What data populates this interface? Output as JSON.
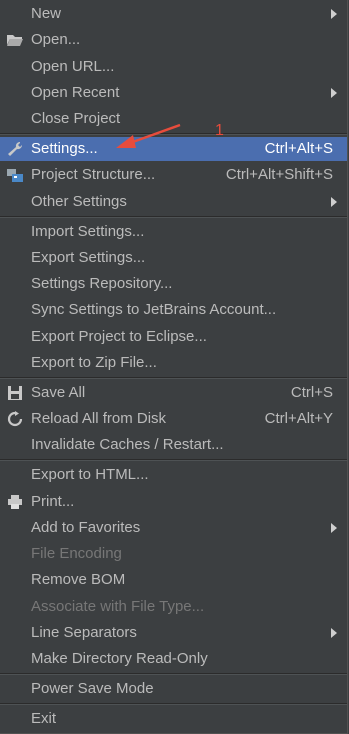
{
  "menu": {
    "new": "New",
    "open": "Open...",
    "open_url": "Open URL...",
    "open_recent": "Open Recent",
    "close_project": "Close Project",
    "settings": "Settings...",
    "settings_shortcut": "Ctrl+Alt+S",
    "project_structure": "Project Structure...",
    "project_structure_shortcut": "Ctrl+Alt+Shift+S",
    "other_settings": "Other Settings",
    "import_settings": "Import Settings...",
    "export_settings": "Export Settings...",
    "settings_repository": "Settings Repository...",
    "sync_settings": "Sync Settings to JetBrains Account...",
    "export_eclipse": "Export Project to Eclipse...",
    "export_zip": "Export to Zip File...",
    "save_all": "Save All",
    "save_all_shortcut": "Ctrl+S",
    "reload_all": "Reload All from Disk",
    "reload_all_shortcut": "Ctrl+Alt+Y",
    "invalidate_caches": "Invalidate Caches / Restart...",
    "export_html": "Export to HTML...",
    "print": "Print...",
    "add_favorites": "Add to Favorites",
    "file_encoding": "File Encoding",
    "remove_bom": "Remove BOM",
    "associate_file_type": "Associate with File Type...",
    "line_separators": "Line Separators",
    "make_readonly": "Make Directory Read-Only",
    "power_save": "Power Save Mode",
    "exit": "Exit"
  },
  "annotation": {
    "number": "1",
    "color": "#e74c3c"
  },
  "icons": {
    "open": "folder-icon",
    "settings": "wrench-icon",
    "project_structure": "project-structure-icon",
    "save_all": "save-icon",
    "reload_all": "reload-icon",
    "print": "printer-icon",
    "submenu": "chevron-right-icon"
  },
  "colors": {
    "background": "#3c3f41",
    "selection": "#4b6eaf",
    "text": "#bbbbbb",
    "disabled_text": "#777777"
  }
}
